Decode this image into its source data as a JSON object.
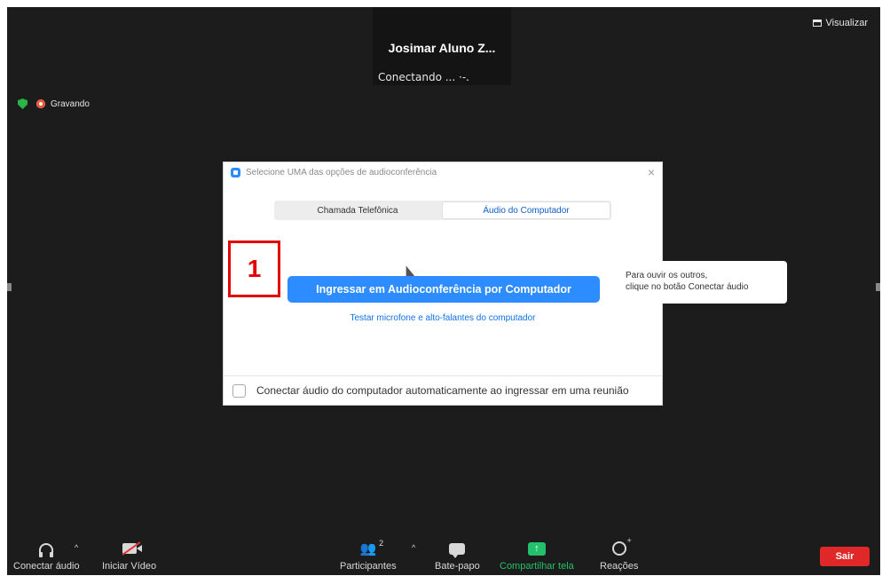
{
  "meeting": {
    "participant_name": "Josimar Aluno Z...",
    "participant_status": "Conectando ... ·-.",
    "view_label": "Visualizar",
    "recording_label": "Gravando"
  },
  "dialog": {
    "title": "Selecione UMA das opções de audioconferência",
    "close": "×",
    "tabs": [
      {
        "label": "Chamada Telefônica",
        "active": false
      },
      {
        "label": "Áudio do Computador",
        "active": true
      }
    ],
    "join_button": "Ingressar em Audioconferência por Computador",
    "test_link": "Testar microfone e alto-falantes do computador",
    "auto_connect_label": "Conectar áudio do computador automaticamente ao ingressar em uma reunião",
    "auto_connect_checked": false
  },
  "annotation": {
    "step_number": "1",
    "tooltip_line1": "Para ouvir os outros,",
    "tooltip_line2": "clique no botão Conectar áudio"
  },
  "toolbar": {
    "connect_audio": "Conectar áudio",
    "start_video": "Iniciar Vídeo",
    "participants": "Participantes",
    "participants_count": "2",
    "chat": "Bate-papo",
    "share_screen": "Compartilhar tela",
    "reactions": "Reações",
    "leave": "Sair"
  },
  "colors": {
    "zoom_blue": "#2d8cff",
    "share_green": "#23c16b",
    "leave_red": "#e02828",
    "marker_red": "#e30000",
    "background": "#1c1c1c"
  }
}
